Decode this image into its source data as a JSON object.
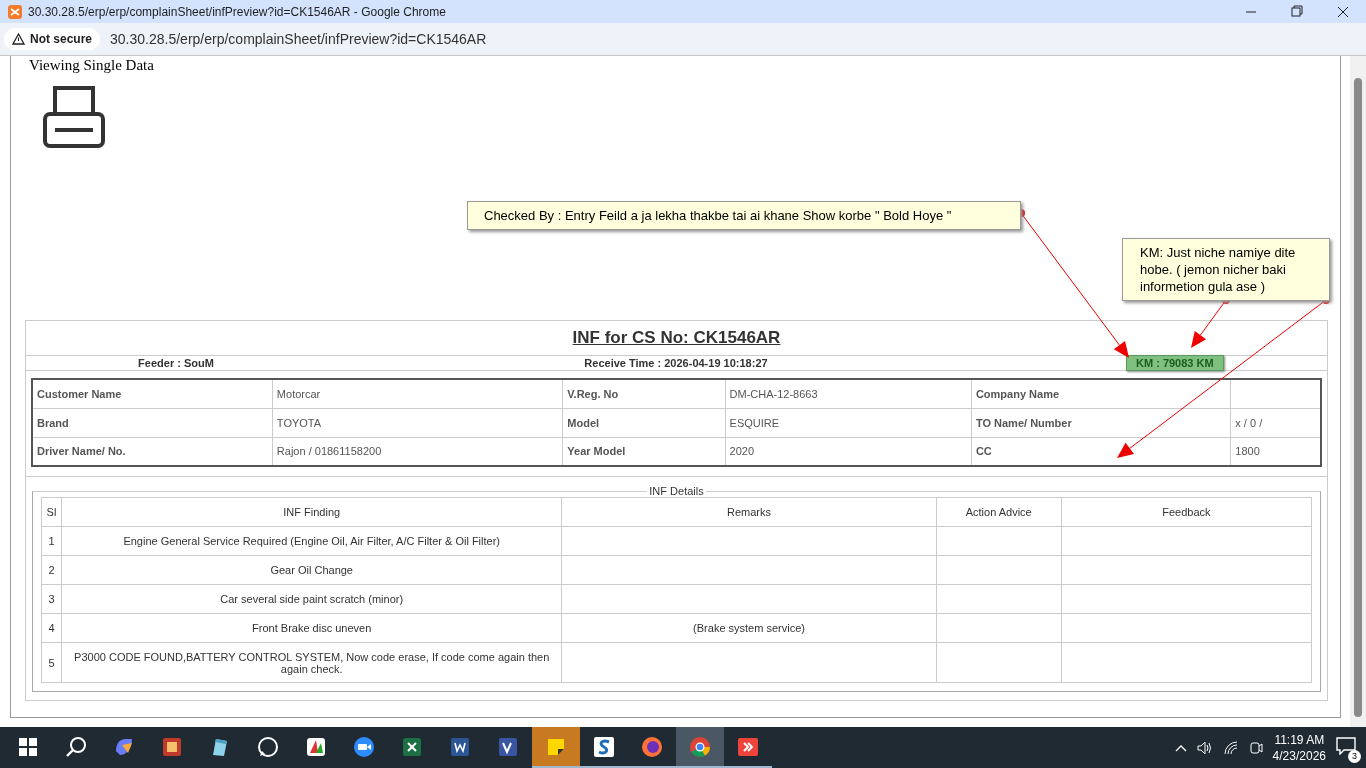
{
  "window": {
    "title": "30.30.28.5/erp/erp/complainSheet/infPreview?id=CK1546AR - Google Chrome"
  },
  "address_bar": {
    "security": "Not secure",
    "url": "30.30.28.5/erp/erp/complainSheet/infPreview?id=CK1546AR"
  },
  "page": {
    "heading": "Viewing Single Data"
  },
  "report": {
    "title": "INF for CS No: CK1546AR",
    "feeder": "Feeder : SouM",
    "receive_time": "Receive Time : 2026-04-19 10:18:27",
    "km": "KM : 79083 KM"
  },
  "vehicle_table": {
    "rows": [
      {
        "cells": [
          "Customer Name",
          "Motorcar",
          "V.Reg. No",
          "DM-CHA-12-8663",
          "Company Name"
        ]
      },
      {
        "cells": [
          "Brand",
          "TOYOTA",
          "Model",
          "ESQUIRE",
          "TO Name/ Number",
          "x / 0 /"
        ]
      },
      {
        "cells": [
          "Driver Name/ No.",
          "Rajon / 01861158200",
          "Year Model",
          "2020",
          "CC",
          "1800"
        ]
      }
    ]
  },
  "inf_details": {
    "legend": "INF Details",
    "columns": [
      "Sl",
      "INF Finding",
      "Remarks",
      "Action Advice",
      "Feedback"
    ],
    "rows": [
      {
        "sl": "1",
        "finding": "Engine General Service Required (Engine Oil, Air Filter, A/C Filter & Oil Filter)"
      },
      {
        "sl": "2",
        "finding": "Gear Oil Change"
      },
      {
        "sl": "3",
        "finding": "Car several side paint scratch (minor)"
      },
      {
        "sl": "4",
        "finding": "Front Brake disc uneven",
        "remarks": "(Brake system service)"
      },
      {
        "sl": "5",
        "finding": "P3000 CODE FOUND,BATTERY CONTROL SYSTEM, Now code erase, If code come again then again check."
      }
    ]
  },
  "annotations": [
    {
      "text": "Checked By : Entry Feild a ja lekha thakbe tai ai khane Show korbe \" Bold Hoye \""
    },
    {
      "text": "KM: Just niche namiye dite hobe. ( jemon nicher baki informetion gula ase )"
    }
  ],
  "taskbar": {
    "apps": [
      {
        "kind": "copilot",
        "open": false,
        "selected": false
      },
      {
        "kind": "book",
        "open": false,
        "selected": false
      },
      {
        "kind": "pen",
        "open": false,
        "selected": false
      },
      {
        "kind": "chat",
        "open": false,
        "selected": false
      },
      {
        "kind": "paint",
        "open": false,
        "selected": false
      },
      {
        "kind": "video",
        "open": false,
        "selected": false
      },
      {
        "kind": "sheet",
        "open": false,
        "selected": false
      },
      {
        "kind": "doc",
        "open": false,
        "selected": false
      },
      {
        "kind": "diagram",
        "open": false,
        "selected": false
      },
      {
        "kind": "note",
        "open": true,
        "selected": false
      },
      {
        "kind": "blue",
        "open": true,
        "selected": false
      },
      {
        "kind": "fox",
        "open": true,
        "selected": false
      },
      {
        "kind": "chrome",
        "open": true,
        "selected": true
      },
      {
        "kind": "remote",
        "open": true,
        "selected": false
      }
    ],
    "time": "11:19 AM",
    "date": "4/23/2026",
    "notifications": "3"
  }
}
